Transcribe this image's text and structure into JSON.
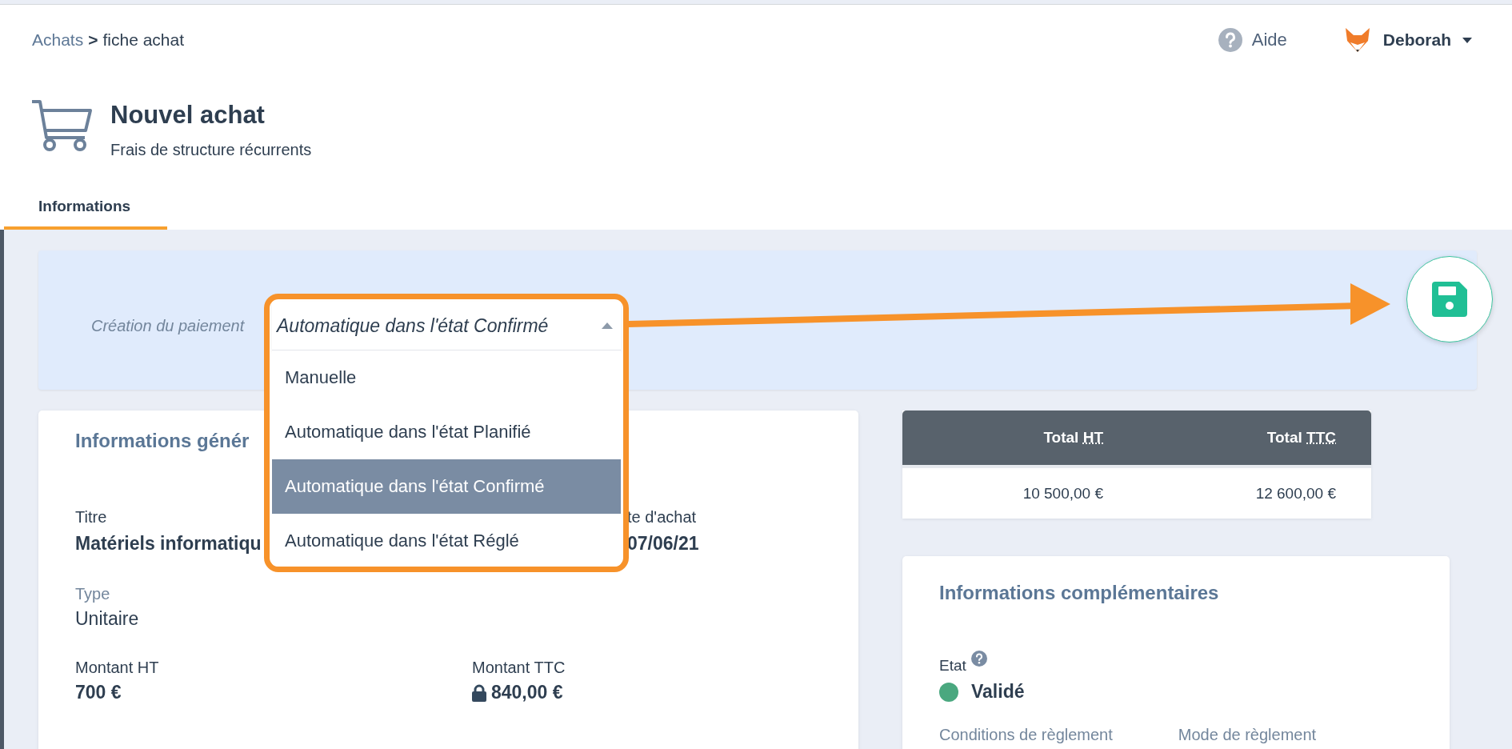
{
  "breadcrumb": {
    "parent": "Achats",
    "separator": ">",
    "current": "fiche achat"
  },
  "header_actions": {
    "help": "Aide",
    "user": "Deborah"
  },
  "page": {
    "title": "Nouvel achat",
    "subtitle": "Frais de structure récurrents"
  },
  "tabs": [
    {
      "label": "Informations",
      "selected": true
    }
  ],
  "payment": {
    "label": "Création du paiement",
    "value": "Automatique dans l'état Confirmé",
    "expanded": true,
    "options": [
      {
        "label": "Manuelle",
        "selected": false
      },
      {
        "label": "Automatique dans l'état Planifié",
        "selected": false
      },
      {
        "label": "Automatique dans l'état Confirmé",
        "selected": true
      },
      {
        "label": "Automatique dans l'état Réglé",
        "selected": false
      }
    ]
  },
  "general_card": {
    "title": "Informations génér",
    "titre": {
      "label": "Titre",
      "value": "Matériels informatiqu"
    },
    "date": {
      "label": "te d'achat",
      "value": "07/06/21"
    },
    "fields": [
      {
        "label": "Type",
        "value": "Unitaire",
        "bold": false,
        "locked": false
      },
      {
        "label": "Montant HT",
        "value": "700 €",
        "bold": true,
        "locked": false
      },
      {
        "label": "Montant TTC",
        "value": "840,00 €",
        "bold": true,
        "locked": true
      }
    ]
  },
  "totals": {
    "columns": [
      {
        "label": "Total",
        "abbr": "HT"
      },
      {
        "label": "Total",
        "abbr": "TTC"
      }
    ],
    "values": [
      "10 500,00 €",
      "12 600,00 €"
    ]
  },
  "extra_card": {
    "title": "Informations complémentaires",
    "state": {
      "label": "Etat",
      "value": "Validé",
      "color": "#4aa87f"
    },
    "fields": [
      "Conditions de règlement",
      "Mode de règlement"
    ]
  }
}
